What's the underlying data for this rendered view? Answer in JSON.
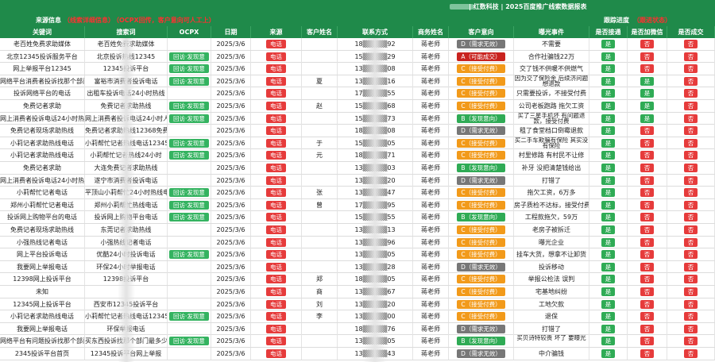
{
  "title": "| 红数科技 | 2025百度推广线索数据报表",
  "section": {
    "source_label": "来源信息",
    "source_note": "（线索详细信息）",
    "ocpx_note": "（OCPX回传，客户意向可人工上）",
    "followup_label": "跟踪进度",
    "followup_note": "（跟进状态）"
  },
  "headers": [
    "关键词",
    "搜索词",
    "OCPX",
    "日期",
    "来源",
    "客户姓名",
    "联系方式",
    "商务姓名",
    "客户意向",
    "曝光事件",
    "是否接通",
    "是否加微信",
    "是否成交"
  ],
  "rows": [
    {
      "kw": "老百姓免费求助媒体",
      "sw": "老百姓免费求助媒体",
      "ocpx": "",
      "date": "2025/3/6",
      "src": "电话",
      "name": "",
      "phone": "18▒▒▒▒▒92",
      "biz": "蒋老师",
      "intent": "D（需求无效）",
      "intent_cls": "b-gray",
      "event": "不需要",
      "conn": "是",
      "wechat": "否",
      "deal": "否"
    },
    {
      "kw": "北京12345投诉服务平台",
      "sw": "北京投诉热线12345",
      "ocpx": "回访·发现意",
      "date": "2025/3/6",
      "src": "电话",
      "name": "",
      "phone": "15▒▒▒▒▒29",
      "biz": "蒋老师",
      "intent": "A（可能成交）",
      "intent_cls": "b-darkred",
      "event": "合作社骗钱22万",
      "conn": "是",
      "wechat": "否",
      "deal": "否"
    },
    {
      "kw": "网上举报平台12345",
      "sw": "12345投诉平台",
      "ocpx": "回访·发现意",
      "date": "2025/3/6",
      "src": "电话",
      "name": "",
      "phone": "13▒▒▒▒▒08",
      "biz": "蒋老师",
      "intent": "C（接受付费）",
      "intent_cls": "b-orange",
      "event": "交了钱不供暖不供燃气",
      "conn": "是",
      "wechat": "否",
      "deal": "否"
    },
    {
      "kw": "网络平台消费者投诉找那个部门最多少",
      "sw": "富裕市消费者投诉电话",
      "ocpx": "回访·发现意",
      "date": "2025/3/6",
      "src": "电话",
      "name": "夏",
      "phone": "13▒▒▒▒▒16",
      "biz": "蒋老师",
      "intent": "C（接受付费）",
      "intent_cls": "b-orange",
      "event": "因为交了保险金 后续济问题 想退款",
      "conn": "是",
      "wechat": "是",
      "deal": "否"
    },
    {
      "kw": "投诉网络平台的电话",
      "sw": "出租车投诉电话24小时热线",
      "ocpx": "",
      "date": "2025/3/6",
      "src": "电话",
      "name": "",
      "phone": "17▒▒▒▒▒55",
      "biz": "蒋老师",
      "intent": "C（接受付费）",
      "intent_cls": "b-orange",
      "event": "只需要投诉，不接受付费",
      "conn": "是",
      "wechat": "是",
      "deal": "否"
    },
    {
      "kw": "免费记者求助",
      "sw": "免费记者求助热线",
      "ocpx": "回访·发现意",
      "date": "2025/3/6",
      "src": "电话",
      "name": "赵",
      "phone": "15▒▒▒▒▒68",
      "biz": "蒋老师",
      "intent": "C（接受付费）",
      "intent_cls": "b-orange",
      "event": "公司老板跑路 拖欠工资",
      "conn": "是",
      "wechat": "是",
      "deal": "否"
    },
    {
      "kw": "网上消费者投诉电话24小时热线",
      "sw": "网上消费者投诉电话24小时人工服务",
      "ocpx": "回访·发现意",
      "date": "2025/3/6",
      "src": "电话",
      "name": "",
      "phone": "15▒▒▒▒▒73",
      "biz": "蒋老师",
      "intent": "B（发现意向）",
      "intent_cls": "b-green",
      "event": "买了三星手机坏 有问题退款，接受付费",
      "conn": "是",
      "wechat": "是",
      "deal": "否"
    },
    {
      "kw": "免费记者现场求助热线",
      "sw": "免费记者求助热线12368免费码",
      "ocpx": "",
      "date": "2025/3/6",
      "src": "电话",
      "name": "",
      "phone": "18▒▒▒▒▒08",
      "biz": "蒋老师",
      "intent": "D（需求无效）",
      "intent_cls": "b-gray",
      "event": "租了食堂档口倒霉退款",
      "conn": "是",
      "wechat": "否",
      "deal": "否"
    },
    {
      "kw": "小莉记者求助热线电话",
      "sw": "小莉帮忙记者热线电话12345",
      "ocpx": "回访·发现意",
      "date": "2025/3/6",
      "src": "电话",
      "name": "于",
      "phone": "15▒▒▒▒▒05",
      "biz": "蒋老师",
      "intent": "C（接受付费）",
      "intent_cls": "b-orange",
      "event": "买二手车欺骗有保险 其实没有保险",
      "conn": "是",
      "wechat": "否",
      "deal": "否"
    },
    {
      "kw": "小莉记者求助热线电话",
      "sw": "小莉帮忙记者热线24小时",
      "ocpx": "回访·发现意",
      "date": "2025/3/6",
      "src": "电话",
      "name": "元",
      "phone": "18▒▒▒▒▒71",
      "biz": "蒋老师",
      "intent": "C（接受付费）",
      "intent_cls": "b-orange",
      "event": "村里修路 有村民不让修",
      "conn": "是",
      "wechat": "否",
      "deal": "否"
    },
    {
      "kw": "免费记者求助",
      "sw": "大连免费记者求助热线",
      "ocpx": "",
      "date": "2025/3/6",
      "src": "电话",
      "name": "",
      "phone": "13▒▒▒▒▒03",
      "biz": "蒋老师",
      "intent": "B（发现意向）",
      "intent_cls": "b-green",
      "event": "补牙 没把清楚钱给出",
      "conn": "是",
      "wechat": "否",
      "deal": "否"
    },
    {
      "kw": "网上消费者投诉电话24小时热线",
      "sw": "遂宁市消费者投诉电话",
      "ocpx": "",
      "date": "2025/3/6",
      "src": "电话",
      "name": "",
      "phone": "13▒▒▒▒▒20",
      "biz": "蒋老师",
      "intent": "D（需求无效）",
      "intent_cls": "b-gray",
      "event": "打错了",
      "conn": "是",
      "wechat": "否",
      "deal": "否"
    },
    {
      "kw": "小莉帮忙记者电话",
      "sw": "平顶山小莉帮忙24小时热线电话",
      "ocpx": "回访·发现意",
      "date": "2025/3/6",
      "src": "电话",
      "name": "张",
      "phone": "13▒▒▒▒▒47",
      "biz": "蒋老师",
      "intent": "C（接受付费）",
      "intent_cls": "b-orange",
      "event": "拖欠工资，6万多",
      "conn": "是",
      "wechat": "否",
      "deal": "否"
    },
    {
      "kw": "郑州小莉帮忙记者电话",
      "sw": "郑州小莉帮忙热线电话",
      "ocpx": "回访·发现意",
      "date": "2025/3/6",
      "src": "电话",
      "name": "曾",
      "phone": "17▒▒▒▒▒95",
      "biz": "蒋老师",
      "intent": "C（接受付费）",
      "intent_cls": "b-orange",
      "event": "房子质检不达标，接受付费",
      "conn": "是",
      "wechat": "否",
      "deal": "否"
    },
    {
      "kw": "投诉网上购物平台的电话",
      "sw": "投诉网上购物平台电话",
      "ocpx": "回访·发现意",
      "date": "2025/3/6",
      "src": "电话",
      "name": "",
      "phone": "15▒▒▒▒▒55",
      "biz": "蒋老师",
      "intent": "B（发现意向）",
      "intent_cls": "b-green",
      "event": "工程款拖欠，59万",
      "conn": "是",
      "wechat": "否",
      "deal": "否"
    },
    {
      "kw": "免费记者现场求助热线",
      "sw": "东莞记者求助热线",
      "ocpx": "",
      "date": "2025/3/6",
      "src": "电话",
      "name": "",
      "phone": "13▒▒▒▒▒13",
      "biz": "蒋老师",
      "intent": "C（接受付费）",
      "intent_cls": "b-orange",
      "event": "老房子被拆迁",
      "conn": "是",
      "wechat": "否",
      "deal": "否"
    },
    {
      "kw": "小强热线记者电话",
      "sw": "小强热线记者电话",
      "ocpx": "",
      "date": "2025/3/6",
      "src": "电话",
      "name": "",
      "phone": "13▒▒▒▒▒96",
      "biz": "蒋老师",
      "intent": "C（接受付费）",
      "intent_cls": "b-orange",
      "event": "曝光企业",
      "conn": "是",
      "wechat": "否",
      "deal": "否"
    },
    {
      "kw": "网上平台投诉电话",
      "sw": "优酷24小时投诉电话",
      "ocpx": "回访·发现意",
      "date": "2025/3/6",
      "src": "电话",
      "name": "",
      "phone": "13▒▒▒▒▒05",
      "biz": "蒋老师",
      "intent": "C（接受付费）",
      "intent_cls": "b-orange",
      "event": "挂车大货，想拿不让卸货",
      "conn": "是",
      "wechat": "否",
      "deal": "否"
    },
    {
      "kw": "我要网上举报电话",
      "sw": "环保24小时举报电话",
      "ocpx": "",
      "date": "2025/3/6",
      "src": "电话",
      "name": "",
      "phone": "13▒▒▒▒▒28",
      "biz": "蒋老师",
      "intent": "D（需求无效）",
      "intent_cls": "b-gray",
      "event": "投诉移动",
      "conn": "是",
      "wechat": "否",
      "deal": "否"
    },
    {
      "kw": "12398网上投诉平台",
      "sw": "12398投诉平台",
      "ocpx": "",
      "date": "2025/3/6",
      "src": "电话",
      "name": "郑",
      "phone": "18▒▒▒▒▒05",
      "biz": "蒋老师",
      "intent": "C（接受付费）",
      "intent_cls": "b-orange",
      "event": "举报公检法 误判",
      "conn": "是",
      "wechat": "否",
      "deal": "否"
    },
    {
      "kw": "未知",
      "sw": "",
      "ocpx": "",
      "date": "2025/3/6",
      "src": "电话",
      "name": "商",
      "phone": "13▒▒▒▒▒67",
      "biz": "蒋老师",
      "intent": "C（接受付费）",
      "intent_cls": "b-orange",
      "event": "宅基地纠纷",
      "conn": "是",
      "wechat": "否",
      "deal": "否"
    },
    {
      "kw": "12345网上投诉平台",
      "sw": "西安市12345投诉平台",
      "ocpx": "",
      "date": "2025/3/6",
      "src": "电话",
      "name": "刘",
      "phone": "13▒▒▒▒▒20",
      "biz": "蒋老师",
      "intent": "C（接受付费）",
      "intent_cls": "b-orange",
      "event": "工地欠款",
      "conn": "是",
      "wechat": "否",
      "deal": "否"
    },
    {
      "kw": "小莉记者求助热线电话",
      "sw": "小莉帮忙记者热线电话12345",
      "ocpx": "回访·发现意",
      "date": "2025/3/6",
      "src": "电话",
      "name": "李",
      "phone": "13▒▒▒▒▒00",
      "biz": "蒋老师",
      "intent": "C（接受付费）",
      "intent_cls": "b-orange",
      "event": "退保",
      "conn": "是",
      "wechat": "否",
      "deal": "否"
    },
    {
      "kw": "我要网上举报电话",
      "sw": "环保举报电话",
      "ocpx": "",
      "date": "2025/3/6",
      "src": "电话",
      "name": "",
      "phone": "18▒▒▒▒▒76",
      "biz": "蒋老师",
      "intent": "D（需求无效）",
      "intent_cls": "b-gray",
      "event": "打错了",
      "conn": "是",
      "wechat": "否",
      "deal": "否"
    },
    {
      "kw": "网络平台有问题投诉找那个部门最多少",
      "sw": "买东西投诉找那个部门最多少",
      "ocpx": "回访·发现意",
      "date": "2025/3/6",
      "src": "电话",
      "name": "",
      "phone": "13▒▒▒▒▒05",
      "biz": "蒋老师",
      "intent": "B（发现意向）",
      "intent_cls": "b-green",
      "event": "买贝诗特较贵 坏了 要曝光",
      "conn": "是",
      "wechat": "否",
      "deal": "否"
    },
    {
      "kw": "2345投诉平台首页",
      "sw": "12345投诉平台网上举报",
      "ocpx": "",
      "date": "2025/3/6",
      "src": "电话",
      "name": "",
      "phone": "13▒▒▒▒▒43",
      "biz": "蒋老师",
      "intent": "D（需求无效）",
      "intent_cls": "b-gray",
      "event": "中介骗钱",
      "conn": "是",
      "wechat": "否",
      "deal": "否"
    }
  ]
}
